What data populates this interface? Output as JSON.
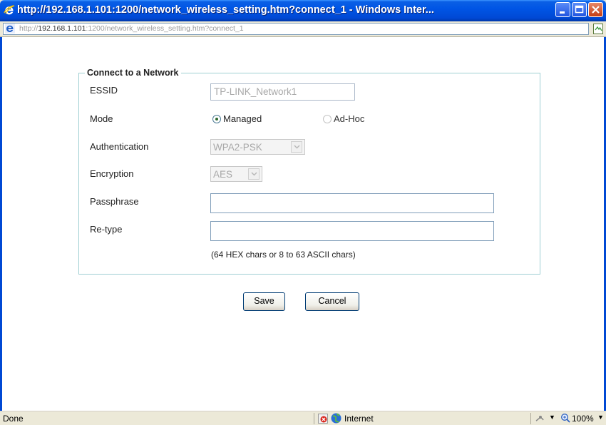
{
  "window": {
    "title": "http://192.168.1.101:1200/network_wireless_setting.htm?connect_1 - Windows Inter...",
    "address_scheme": "http://",
    "address_host": "192.168.1.101",
    "address_rest": ":1200/network_wireless_setting.htm?connect_1"
  },
  "form": {
    "legend": "Connect to a Network",
    "essid_label": "ESSID",
    "essid_value": "TP-LINK_Network1",
    "mode_label": "Mode",
    "mode_managed": "Managed",
    "mode_adhoc": "Ad-Hoc",
    "mode_selected": "Managed",
    "auth_label": "Authentication",
    "auth_value": "WPA2-PSK",
    "enc_label": "Encryption",
    "enc_value": "AES",
    "pass_label": "Passphrase",
    "pass_value": "",
    "retype_label": "Re-type",
    "retype_value": "",
    "hint": "(64 HEX chars or 8 to 63 ASCII chars)"
  },
  "buttons": {
    "save": "Save",
    "cancel": "Cancel"
  },
  "status": {
    "text": "Done",
    "zone": "Internet",
    "zoom": "100%"
  },
  "colors": {
    "titlebar": "#0055e5",
    "fieldset_border": "#9fcfd3"
  }
}
